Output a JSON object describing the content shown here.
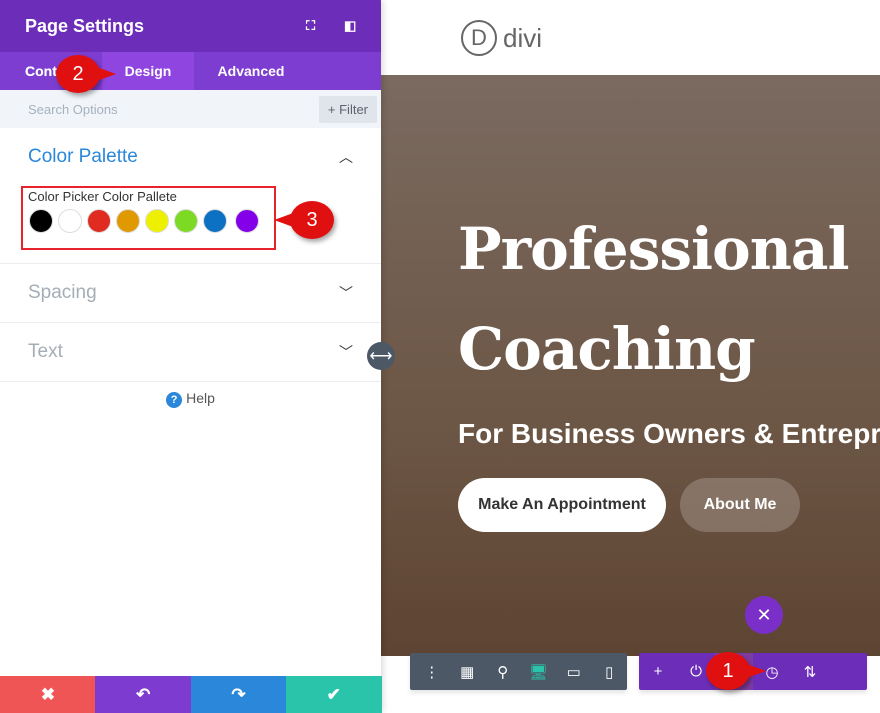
{
  "panel": {
    "title": "Page Settings",
    "tabs": [
      "Content",
      "Design",
      "Advanced"
    ],
    "tab_visible": "Cont",
    "search_placeholder": "Search Options",
    "filter": "+ Filter",
    "sections": [
      {
        "label": "Color Palette",
        "open": true
      },
      {
        "label": "Spacing"
      },
      {
        "label": "Text"
      }
    ],
    "palette_label": "Color Picker Color Pallete",
    "palette": [
      "#000000",
      "#ffffff",
      "#e02b20",
      "#e09900",
      "#edf000",
      "#7cda24",
      "#0c71c3",
      "#8300e9"
    ],
    "help": "Help",
    "help_icon": "?",
    "footer": [
      {
        "icon": "✖",
        "color": "#ef5555"
      },
      {
        "icon": "↶",
        "color": "#7e3bd0"
      },
      {
        "icon": "↷",
        "color": "#2b87da"
      },
      {
        "icon": "✔",
        "color": "#29c4a9"
      }
    ]
  },
  "markers": [
    "1",
    "2",
    "3"
  ],
  "site": {
    "logo_letter": "D",
    "logo": "divi",
    "heading1": "Professional",
    "heading2": "Coaching",
    "subheading": "For Business Owners & Entrepreneurs",
    "button1": "Make An Appointment",
    "button2": "About Me",
    "close": "✕"
  },
  "toolbar_left": [
    "⋮",
    "▦",
    "⚲",
    "🖥",
    "▭",
    "▯"
  ],
  "toolbar_right": [
    "+",
    "⏻",
    "⚙",
    "◷",
    "⇅"
  ]
}
